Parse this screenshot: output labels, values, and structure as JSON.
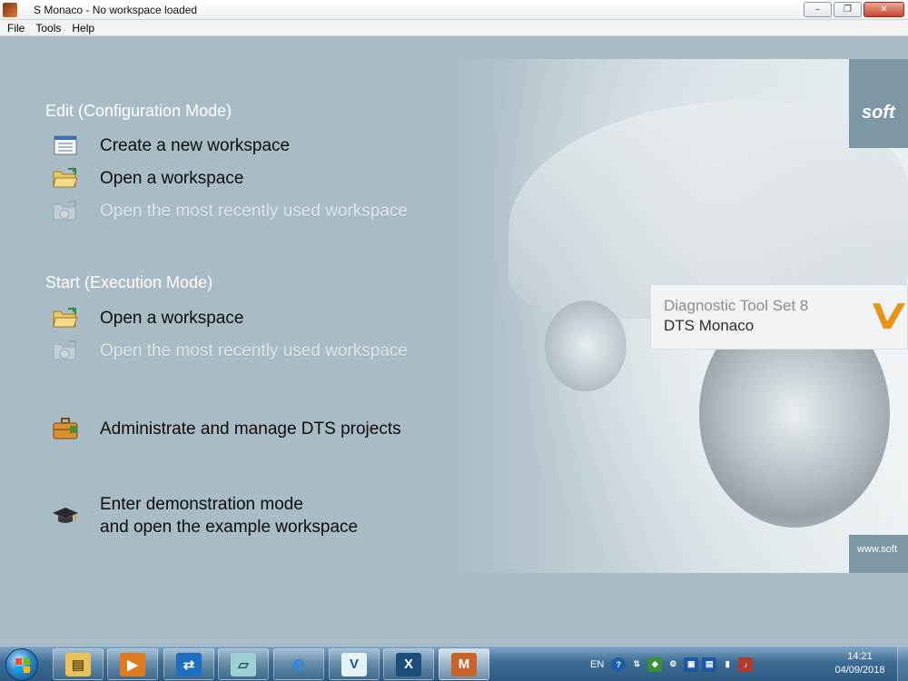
{
  "window": {
    "title": "S Monaco  -  No workspace loaded",
    "minimize_glyph": "–",
    "maximize_glyph": "❐",
    "close_glyph": "✕"
  },
  "menu": [
    "File",
    "Tools",
    "Help"
  ],
  "edit_section": {
    "title": "Edit (Configuration Mode)",
    "actions": [
      {
        "label": "Create a new workspace",
        "icon": "document-list-icon",
        "enabled": true
      },
      {
        "label": "Open a workspace",
        "icon": "open-folder-icon",
        "enabled": true
      },
      {
        "label": "Open the most recently used workspace",
        "icon": "recent-folder-icon",
        "enabled": false
      }
    ]
  },
  "start_section": {
    "title": "Start (Execution Mode)",
    "actions": [
      {
        "label": "Open a workspace",
        "icon": "open-folder-icon",
        "enabled": true
      },
      {
        "label": "Open the most recently used workspace",
        "icon": "recent-folder-icon",
        "enabled": false
      }
    ]
  },
  "admin_action": {
    "label": "Administrate and manage DTS projects",
    "icon": "briefcase-icon"
  },
  "demo_action": {
    "line1": "Enter demonstration mode",
    "line2": "and open the example workspace",
    "icon": "graduation-cap-icon"
  },
  "banner": {
    "line1": "Diagnostic Tool Set 8",
    "line2": "DTS Monaco"
  },
  "brand": {
    "logo_text": "soft",
    "website": "www.soft"
  },
  "taskbar": {
    "apps": [
      {
        "name": "explorer",
        "icon": "folder-icon",
        "glyph": "▤",
        "color": "#e8c15a"
      },
      {
        "name": "media-player",
        "icon": "media-player-icon",
        "glyph": "▶",
        "color": "#e07a1f"
      },
      {
        "name": "teamviewer",
        "icon": "teamviewer-icon",
        "glyph": "⇄",
        "color": "#1e6fc0"
      },
      {
        "name": "notes",
        "icon": "notes-icon",
        "glyph": "▱",
        "color": "#9ed0d6"
      },
      {
        "name": "internet-explorer",
        "icon": "internet-explorer-icon",
        "glyph": "e",
        "color": "#2b8be0"
      },
      {
        "name": "vediamo",
        "icon": "vediamo-icon",
        "glyph": "V",
        "color": "#e7f2f6"
      },
      {
        "name": "xentry",
        "icon": "xentry-icon",
        "glyph": "X",
        "color": "#1c4f7a"
      },
      {
        "name": "dts-monaco",
        "icon": "monaco-icon",
        "glyph": "M",
        "color": "#c8642a"
      }
    ],
    "language": "EN",
    "tray_icons": [
      "help-icon",
      "network-icon",
      "shield-icon",
      "gear-icon",
      "monitor-icon",
      "battery-icon",
      "signal-icon",
      "volume-icon"
    ],
    "time": "14:21",
    "date": "04/09/2018"
  }
}
